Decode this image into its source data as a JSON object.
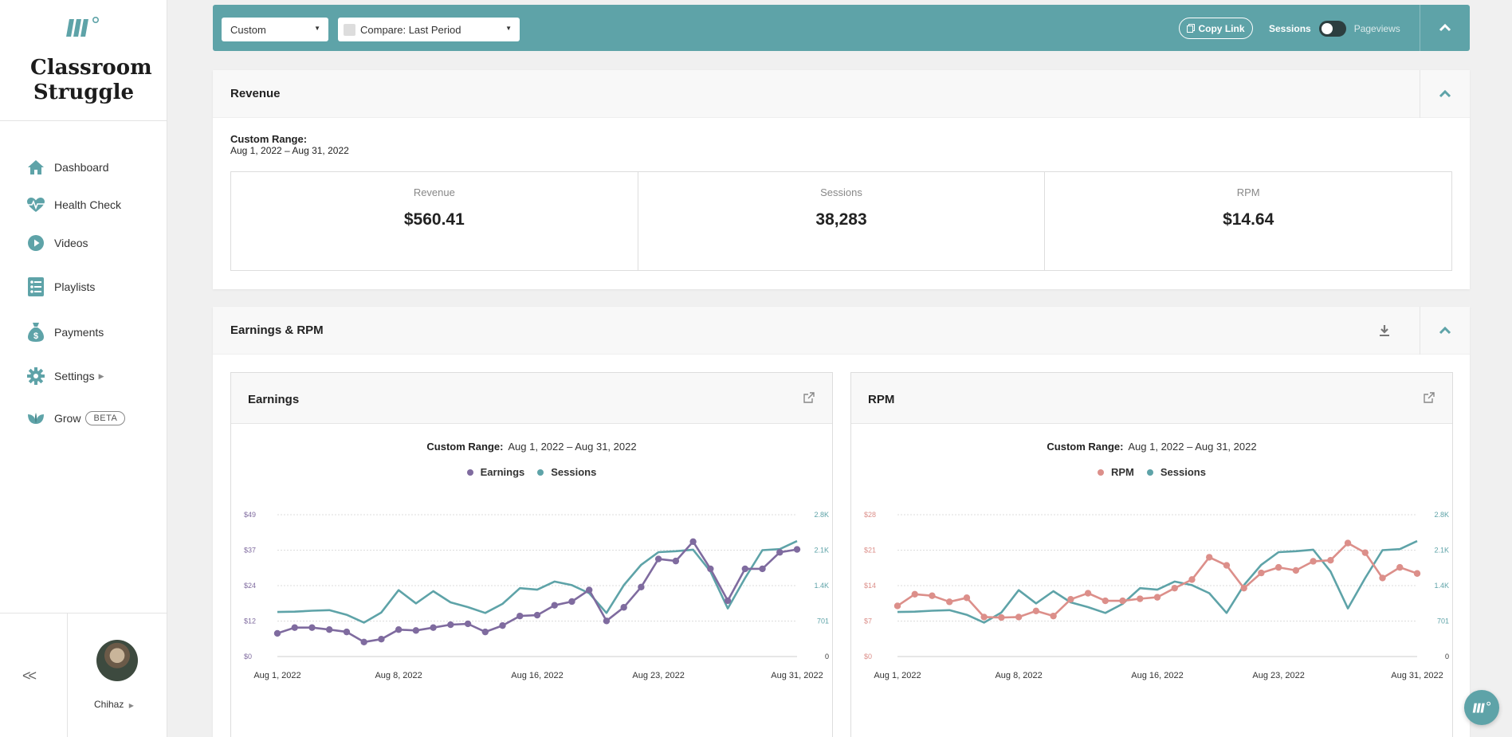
{
  "sidebar": {
    "brand": "Classroom Struggle",
    "items": [
      {
        "label": "Dashboard",
        "icon": "home-icon"
      },
      {
        "label": "Health Check",
        "icon": "heartbeat-icon"
      },
      {
        "label": "Videos",
        "icon": "play-circle-icon"
      },
      {
        "label": "Playlists",
        "icon": "list-icon"
      },
      {
        "label": "Payments",
        "icon": "money-bag-icon"
      },
      {
        "label": "Settings",
        "icon": "gear-icon"
      },
      {
        "label": "Grow",
        "icon": "leaf-icon",
        "badge": "BETA"
      }
    ],
    "collapse_label": "<<",
    "user_name": "Chihaz"
  },
  "toolbar": {
    "range_select": "Custom",
    "compare_select": "Compare: Last Period",
    "copy_link": "Copy Link",
    "toggle_left": "Sessions",
    "toggle_right": "Pageviews"
  },
  "revenue_panel": {
    "title": "Revenue",
    "range_label": "Custom Range:",
    "range_value": "Aug 1, 2022 – Aug 31, 2022",
    "metrics": [
      {
        "label": "Revenue",
        "value": "$560.41"
      },
      {
        "label": "Sessions",
        "value": "38,283"
      },
      {
        "label": "RPM",
        "value": "$14.64"
      }
    ]
  },
  "earnings_panel": {
    "title": "Earnings & RPM"
  },
  "colors": {
    "accent": "#5ea3a8",
    "earnings": "#7f6b9f",
    "rpm": "#dc8f8a",
    "sessions": "#5ea3a8"
  },
  "chart_data": [
    {
      "type": "line",
      "card_title": "Earnings",
      "subtitle_label": "Custom Range:",
      "subtitle_value": "Aug 1, 2022 – Aug 31, 2022",
      "x_tick_labels": [
        "Aug 1, 2022",
        "Aug 8, 2022",
        "Aug 16, 2022",
        "Aug 23, 2022",
        "Aug 31, 2022"
      ],
      "x_tick_days": [
        1,
        8,
        16,
        23,
        31
      ],
      "y_left_ticks": [
        "$0",
        "$12",
        "$24",
        "$37",
        "$49"
      ],
      "y_left_max": 49,
      "y_right_ticks": [
        "0",
        "701",
        "1.4K",
        "2.1K",
        "2.8K"
      ],
      "y_right_max": 2800,
      "grid": true,
      "legend_position": "top-center",
      "series": [
        {
          "name": "Earnings",
          "axis": "left",
          "markers": true,
          "values": [
            8,
            10,
            10,
            9.3,
            8.5,
            5,
            6,
            9.3,
            9,
            10,
            11,
            11.3,
            8.5,
            10.7,
            14,
            14.3,
            17.7,
            19,
            23,
            12.3,
            17,
            24,
            33.7,
            33,
            39.7,
            30.3,
            19.3,
            30.3,
            30.3,
            36,
            37
          ]
        },
        {
          "name": "Sessions",
          "axis": "right",
          "markers": false,
          "values": [
            880,
            885,
            905,
            915,
            825,
            670,
            870,
            1310,
            1050,
            1290,
            1070,
            975,
            860,
            1040,
            1350,
            1320,
            1480,
            1410,
            1250,
            860,
            1410,
            1810,
            2060,
            2080,
            2110,
            1680,
            950,
            1550,
            2100,
            2120,
            2280
          ]
        }
      ]
    },
    {
      "type": "line",
      "card_title": "RPM",
      "subtitle_label": "Custom Range:",
      "subtitle_value": "Aug 1, 2022 – Aug 31, 2022",
      "x_tick_labels": [
        "Aug 1, 2022",
        "Aug 8, 2022",
        "Aug 16, 2022",
        "Aug 23, 2022",
        "Aug 31, 2022"
      ],
      "x_tick_days": [
        1,
        8,
        16,
        23,
        31
      ],
      "y_left_ticks": [
        "$0",
        "$7",
        "$14",
        "$21",
        "$28"
      ],
      "y_left_max": 28,
      "y_right_ticks": [
        "0",
        "701",
        "1.4K",
        "2.1K",
        "2.8K"
      ],
      "y_right_max": 2800,
      "grid": true,
      "legend_position": "top-center",
      "series": [
        {
          "name": "RPM",
          "axis": "left",
          "markers": true,
          "values": [
            10,
            12.3,
            12,
            10.8,
            11.6,
            7.8,
            7.7,
            7.8,
            9,
            8,
            11.3,
            12.5,
            11,
            11,
            11.4,
            11.7,
            13.5,
            15.2,
            19.6,
            18,
            13.5,
            16.5,
            17.6,
            17,
            18.8,
            19,
            22.4,
            20.5,
            15.5,
            17.6,
            16.4
          ]
        },
        {
          "name": "Sessions",
          "axis": "right",
          "markers": false,
          "values": [
            880,
            885,
            905,
            915,
            825,
            670,
            870,
            1310,
            1050,
            1290,
            1070,
            975,
            860,
            1040,
            1350,
            1320,
            1480,
            1410,
            1250,
            860,
            1410,
            1810,
            2060,
            2080,
            2110,
            1680,
            950,
            1550,
            2100,
            2120,
            2280
          ]
        }
      ]
    }
  ]
}
